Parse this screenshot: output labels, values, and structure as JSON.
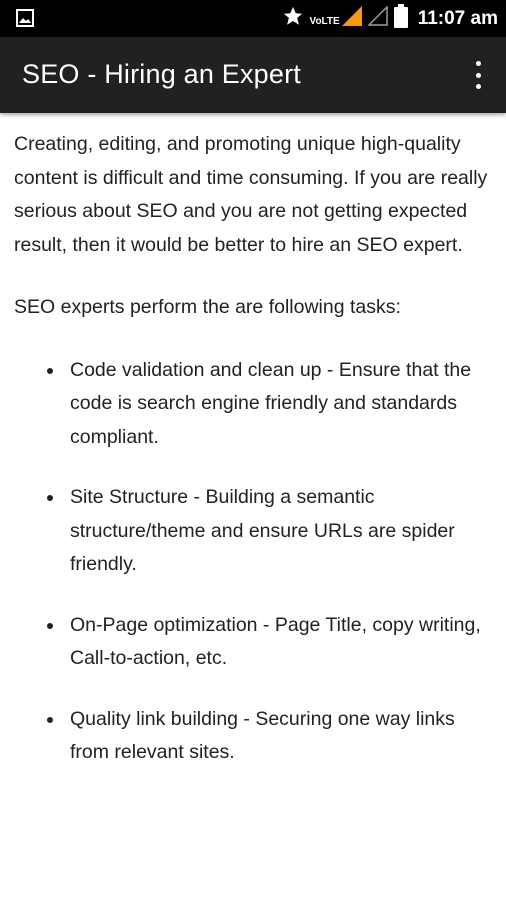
{
  "status_bar": {
    "network_label": "VoLTE",
    "time": "11:07 am",
    "icons": [
      "gallery-icon",
      "star-icon",
      "signal-icon",
      "signal-empty-icon",
      "battery-icon"
    ],
    "accent_color": "#f39c12"
  },
  "app_bar": {
    "title": "SEO - Hiring an Expert",
    "menu_icon": "more-vert-icon"
  },
  "content": {
    "intro": "Creating, editing, and promoting unique high-quality content is difficult and time consuming. If you are really serious about SEO and you are not getting expected result, then it would be better to hire an SEO expert.",
    "lead": "SEO experts perform the are following tasks:",
    "tasks": [
      "Code validation and clean up - Ensure that the code is search engine friendly and standards compliant.",
      "Site Structure - Building a semantic structure/theme and ensure URLs are spider friendly.",
      "On-Page optimization - Page Title, copy writing, Call-to-action, etc.",
      "Quality link building - Securing one way links from relevant sites."
    ]
  }
}
